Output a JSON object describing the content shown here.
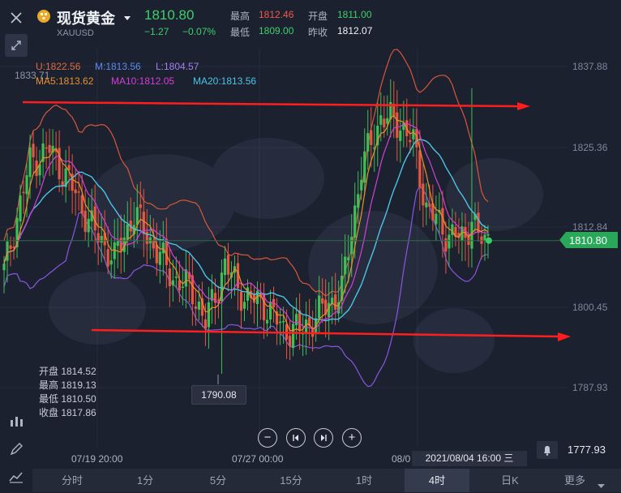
{
  "header": {
    "name": "现货黄金",
    "symbol": "XAUUSD",
    "price": "1810.80",
    "change": "−1.27",
    "change_pct": "−0.07%",
    "high_label": "最高",
    "high": "1812.46",
    "open_label": "开盘",
    "open": "1811.00",
    "low_label": "最低",
    "low": "1809.00",
    "prev_label": "昨收",
    "prev": "1812.07"
  },
  "indicators": {
    "u": "U:1822.56",
    "m": "M:1813.56",
    "l": "L:1804.57",
    "ma5": "MA5:1813.62",
    "ma10": "MA10:1812.05",
    "ma20": "MA20:1813.56",
    "overlap": "1833.71"
  },
  "ohlc_info": {
    "open": "开盘 1814.52",
    "high": "最高 1819.13",
    "low": "最低 1810.50",
    "close": "收盘 1817.86"
  },
  "colors": {
    "up": "#3fbf55",
    "down": "#e8573f",
    "upper": "#d8563c",
    "mid": "#4cc4e6",
    "lower": "#8a56e0",
    "ma5": "#e8922c",
    "ma10": "#d43fd4",
    "arrow": "#ff1e1e"
  },
  "chart_data": {
    "type": "candlestick",
    "yticks": [
      "1837.88",
      "1825.36",
      "1812.84",
      "1800.45",
      "1787.93"
    ],
    "xlabels": [
      "07/19 20:00",
      "07/27 00:00",
      "08/0"
    ],
    "current_price_label": "1810.80",
    "min_marker": "1790.08",
    "bell_price": "1777.93",
    "crosshair_time": "2021/08/04 16:00 三",
    "ylim": [
      1777.93,
      1837.88
    ]
  },
  "toolbar": {
    "zoom_out": "−",
    "prev": "◀",
    "next": "▶",
    "zoom_in": "+"
  },
  "tabs": [
    "分时",
    "1分",
    "5分",
    "15分",
    "1时",
    "4时",
    "日K",
    "更多"
  ],
  "active_tab": "4时"
}
